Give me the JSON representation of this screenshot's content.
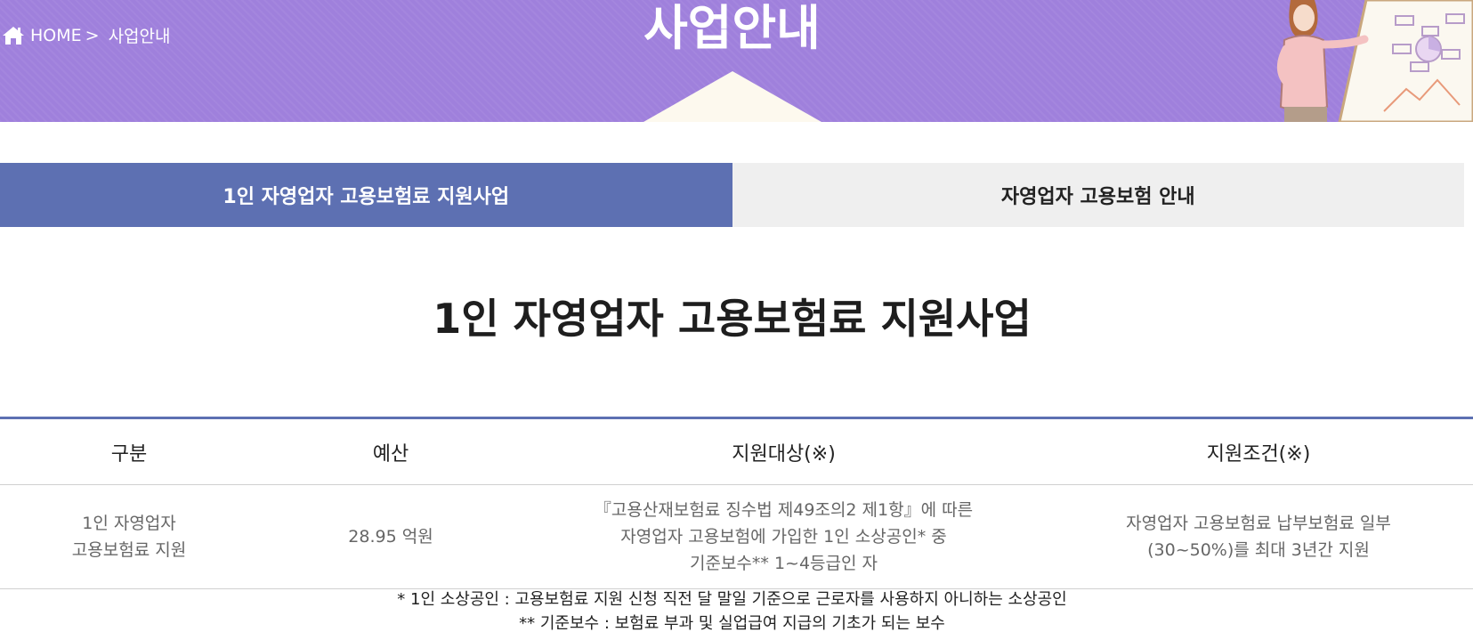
{
  "header": {
    "breadcrumb": {
      "home_icon": "home-icon",
      "home_label": "HOME",
      "separator": ">",
      "current": "사업안내"
    },
    "title": "사업안내",
    "illustration": "presenter-with-chart-board",
    "colors": {
      "background": "#9f80dc",
      "triangle": "#fdf9ee"
    }
  },
  "tabs": [
    {
      "label": "1인 자영업자 고용보험료 지원사업",
      "active": true
    },
    {
      "label": "자영업자 고용보험 안내",
      "active": false
    }
  ],
  "main": {
    "title": "1인 자영업자 고용보험료 지원사업",
    "table": {
      "headers": [
        "구분",
        "예산",
        "지원대상(※)",
        "지원조건(※)"
      ],
      "row": {
        "category": "1인 자영업자\n고용보험료 지원",
        "budget": "28.95 억원",
        "target": "『고용산재보험료 징수법 제49조의2 제1항』에 따른\n자영업자 고용보험에 가입한 1인 소상공인* 중\n기준보수** 1~4등급인 자",
        "condition": "자영업자 고용보험료 납부보험료 일부\n(30~50%)를 최대 3년간 지원"
      }
    },
    "notes": [
      "* 1인 소상공인 : 고용보험료 지원 신청 직전 달 말일 기준으로 근로자를 사용하지 아니하는 소상공인",
      "** 기준보수 : 보험료 부과 및 실업급여 지급의 기초가 되는 보수"
    ]
  },
  "colors": {
    "active_tab": "#5d70b2",
    "inactive_tab": "#efefef",
    "table_top_border": "#5d70b2"
  }
}
